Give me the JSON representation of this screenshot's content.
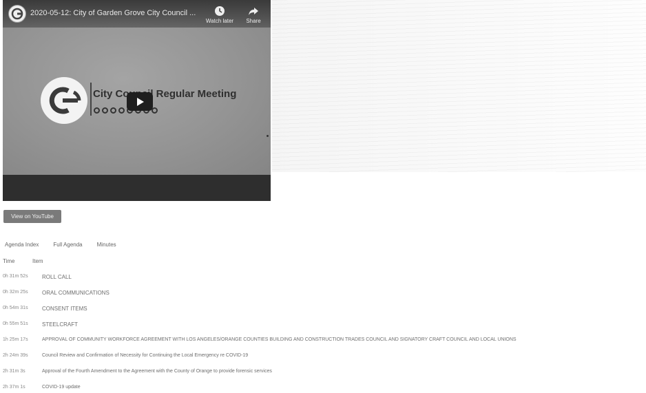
{
  "player": {
    "video_title": "2020-05-12: City of Garden Grove City Council ...",
    "watch_later_label": "Watch later",
    "share_label": "Share",
    "thumbnail_title": "City Council Regular Meeting"
  },
  "view_on_youtube_label": "View on YouTube",
  "tabs": [
    "Agenda Index",
    "Full Agenda",
    "Minutes"
  ],
  "table": {
    "headers": {
      "time": "Time",
      "item": "Item"
    },
    "rows": [
      {
        "time": "0h 31m 52s",
        "item": "ROLL CALL"
      },
      {
        "time": "0h 32m 25s",
        "item": "ORAL COMMUNICATIONS"
      },
      {
        "time": "0h 54m 31s",
        "item": "CONSENT ITEMS"
      },
      {
        "time": "0h 55m 51s",
        "item": "STEELCRAFT"
      },
      {
        "time": "1h 25m 17s",
        "item": "APPROVAL OF COMMUNITY WORKFORCE AGREEMENT WITH LOS ANGELES/ORANGE COUNTIES BUILDING AND CONSTRUCTION TRADES COUNCIL AND SIGNATORY CRAFT COUNCIL AND LOCAL UNIONS"
      },
      {
        "time": "2h 24m 39s",
        "item": "Council Review and Confirmation of Necessity for Continuing the Local Emergency re COVID-19"
      },
      {
        "time": "2h 31m 3s",
        "item": "Approval of the Fourth Amendment to the Agreement with the County of Orange to provide forensic services"
      },
      {
        "time": "2h 37m 1s",
        "item": "COVID-19 update"
      }
    ]
  },
  "colors": {
    "player_bg": "#8c8c8c",
    "button_bg": "#7a7a7a",
    "play_button": "#1f1f1f"
  },
  "icons": {
    "watch_later": "clock-icon",
    "share": "share-arrow-icon",
    "play": "play-icon",
    "channel": "city-logo-icon"
  }
}
